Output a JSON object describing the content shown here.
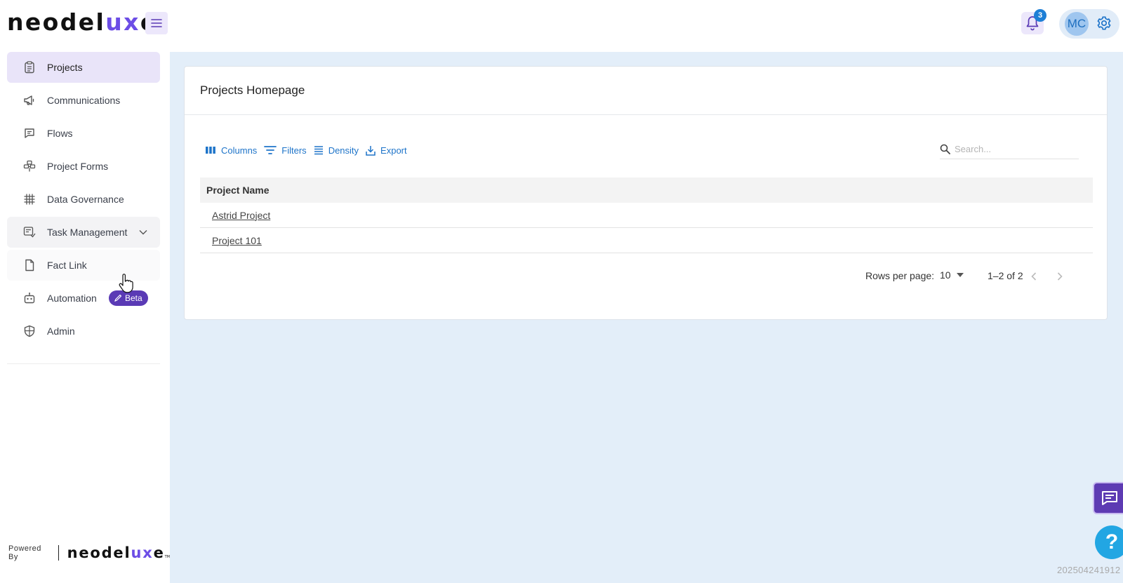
{
  "app": {
    "logo_main": "neodel",
    "logo_accent": "ux",
    "logo_end": "e",
    "logo_tm": "TM"
  },
  "header": {
    "notification_count": "3",
    "user_initials": "MC"
  },
  "sidebar": {
    "items": [
      {
        "label": "Projects",
        "icon": "clipboard-icon"
      },
      {
        "label": "Communications",
        "icon": "megaphone-icon"
      },
      {
        "label": "Flows",
        "icon": "message-icon"
      },
      {
        "label": "Project Forms",
        "icon": "flow-chart-icon"
      },
      {
        "label": "Data Governance",
        "icon": "grid-hash-icon"
      },
      {
        "label": "Task Management",
        "icon": "task-icon"
      },
      {
        "label": "Fact Link",
        "icon": "file-icon"
      },
      {
        "label": "Automation",
        "icon": "robot-icon"
      },
      {
        "label": "Admin",
        "icon": "shield-icon"
      }
    ],
    "beta_label": "Beta",
    "powered_by": "Powered By"
  },
  "main": {
    "title": "Projects Homepage",
    "toolbar": {
      "columns": "Columns",
      "filters": "Filters",
      "density": "Density",
      "export": "Export"
    },
    "search_placeholder": "Search...",
    "table": {
      "column_header": "Project Name",
      "rows": [
        "Astrid Project",
        "Project 101"
      ]
    },
    "pagination": {
      "rows_per_page_label": "Rows per page:",
      "rows_per_page_value": "10",
      "range": "1–2 of 2"
    }
  },
  "footer": {
    "version": "202504241912"
  },
  "colors": {
    "brand_purple": "#5a3ab5",
    "accent_blue": "#1e74c9",
    "main_bg": "#e3eef9",
    "active_nav_bg": "#e9e4f9"
  }
}
